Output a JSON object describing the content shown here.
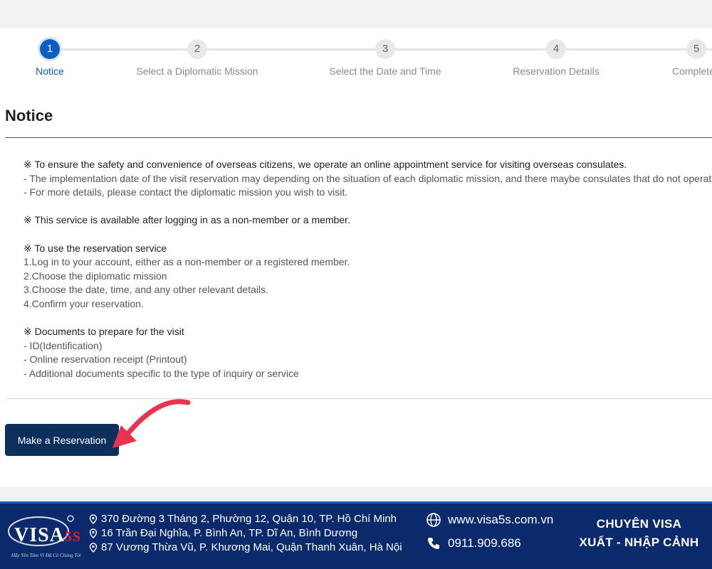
{
  "stepper": {
    "steps": [
      {
        "number": "1",
        "label": "Notice",
        "active": true
      },
      {
        "number": "2",
        "label": "Select a Diplomatic Mission",
        "active": false
      },
      {
        "number": "3",
        "label": "Select the Date and Time",
        "active": false
      },
      {
        "number": "4",
        "label": "Reservation Details",
        "active": false
      },
      {
        "number": "5",
        "label": "Complete",
        "active": false
      }
    ]
  },
  "notice": {
    "title": "Notice",
    "lines": [
      "※ To ensure the safety and convenience of overseas citizens, we operate an online appointment service for visiting overseas consulates.",
      "- The implementation date of the visit reservation may depending on the situation of each diplomatic mission, and there maybe consulates that do not operate.",
      "- For more details, please contact the diplomatic mission you wish to visit.",
      "※ This service is available after logging in as a non-member or a member.",
      "※ To use the reservation service",
      "1.Log in to your account, either as a non-member or a registered member.",
      "2.Choose the diplomatic mission",
      "3.Choose the date, time, and any other relevant details.",
      "4.Confirm your reservation.",
      "※ Documents to prepare for the visit",
      "- ID(Identification)",
      "- Online reservation receipt (Printout)",
      "- Additional documents specific to the type of inquiry or service"
    ]
  },
  "actions": {
    "reserve_label": "Make a Reservation"
  },
  "footer": {
    "logo_text": "VISA",
    "logo_accent": "5S",
    "logo_tagline": "Hãy Yên Tâm Vì Đã Có Chúng Tôi",
    "addresses": [
      "370 Đường 3 Tháng 2, Phường 12, Quận 10, TP. Hồ Chí Minh",
      "16 Trần Đại Nghĩa, P. Bình An, TP. Dĩ An, Bình Dương",
      "87 Vương Thừa Vũ, P. Khương Mai, Quận Thanh Xuân, Hà Nội"
    ],
    "website": "www.visa5s.com.vn",
    "phone": "0911.909.686",
    "slogan_line1": "CHUYÊN VISA",
    "slogan_line2": "XUẤT - NHẬP CẢNH"
  },
  "colors": {
    "accent": "#0d5fbf",
    "button": "#0d2f5c",
    "arrow": "#e8344e",
    "footer_bg": "#0b2a6b"
  }
}
